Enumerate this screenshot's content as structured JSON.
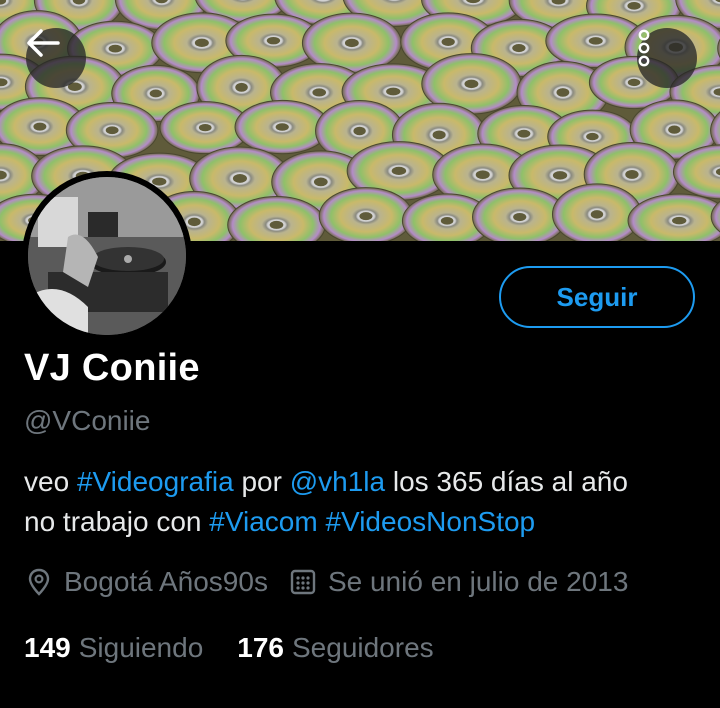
{
  "profile": {
    "name": "VJ Coniie",
    "handle": "@VConiie",
    "bio": {
      "word1": "veo",
      "hashtag1": "#Videografia",
      "word2": "por",
      "mention": "@vh1la",
      "word3": "los 365 días al año",
      "line2_start": "no trabajo con",
      "hashtag2": "#Viacom",
      "hashtag3": "#VideosNonStop"
    },
    "location": "Bogotá Años90s",
    "joined": "Se unió en julio de 2013",
    "following_count": "149",
    "following_label": "Siguiendo",
    "followers_count": "176",
    "followers_label": "Seguidores"
  },
  "actions": {
    "follow_label": "Seguir"
  },
  "icons": {
    "back": "arrow-left-icon",
    "more": "more-vertical-icon",
    "location": "location-pin-icon",
    "calendar": "calendar-icon"
  },
  "colors": {
    "background": "#000000",
    "accent": "#1d9bf0",
    "secondary_text": "#6e767d"
  }
}
